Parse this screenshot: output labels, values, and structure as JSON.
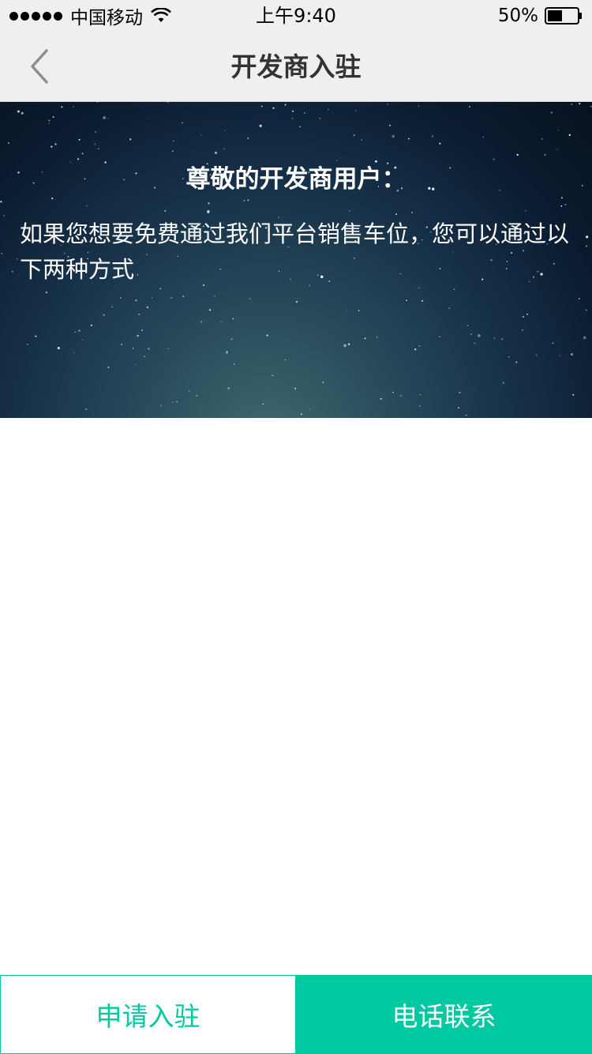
{
  "status_bar": {
    "carrier": "中国移动",
    "time": "上午9:40",
    "battery_percent": "50%",
    "battery_level": 0.5,
    "icons": [
      "signal-icon",
      "wifi-icon",
      "battery-icon"
    ]
  },
  "nav": {
    "title": "开发商入驻",
    "back_icon": "chevron-left-icon"
  },
  "banner": {
    "heading": "尊敬的开发商用户：",
    "text": "如果您想要免费通过我们平台销售车位，您可以通过以下两种方式"
  },
  "actions": {
    "apply_label": "申请入驻",
    "call_label": "电话联系"
  },
  "colors": {
    "accent": "#00c8a0",
    "nav_background": "#efefef",
    "title_text": "#333333"
  }
}
